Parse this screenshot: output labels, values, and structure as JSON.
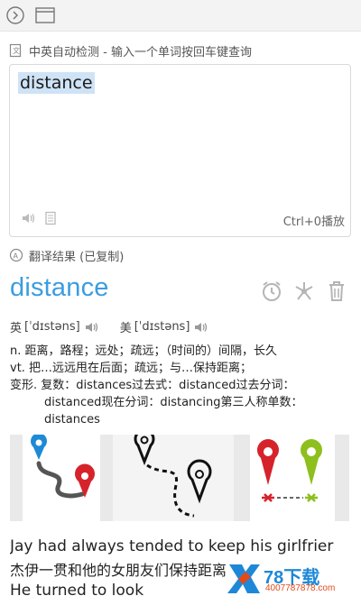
{
  "source": {
    "label": "中英自动检测 - 输入一个单词按回车键查询",
    "input_value": "distance",
    "play_shortcut": "Ctrl+0播放"
  },
  "result": {
    "label": "翻译结果 (已复制)",
    "headword": "distance",
    "phonetic_uk_label": "英",
    "phonetic_uk": "[ˈdɪstəns]",
    "phonetic_us_label": "美",
    "phonetic_us": "[ˈdɪstəns]",
    "definitions": [
      "n. 距离，路程；远处；疏远；（时间的）间隔，长久",
      "vt. 把…远远甩在后面；疏远；与…保持距离；",
      "变形. 复数：distances过去式：distanced过去分词：",
      "distanced现在分词：distancing第三人称单数：",
      "distances"
    ],
    "example_en": "Jay had always tended to keep his girlfrier",
    "example_cn": "杰伊一贯和他的女朋友们保持距离",
    "example_next": "He turned to look"
  },
  "watermark": {
    "brand": "78下载",
    "url": "4007787878.com"
  },
  "colors": {
    "accent": "#3b9de0",
    "pin_red": "#d6232b",
    "pin_green": "#8dbf1e"
  }
}
